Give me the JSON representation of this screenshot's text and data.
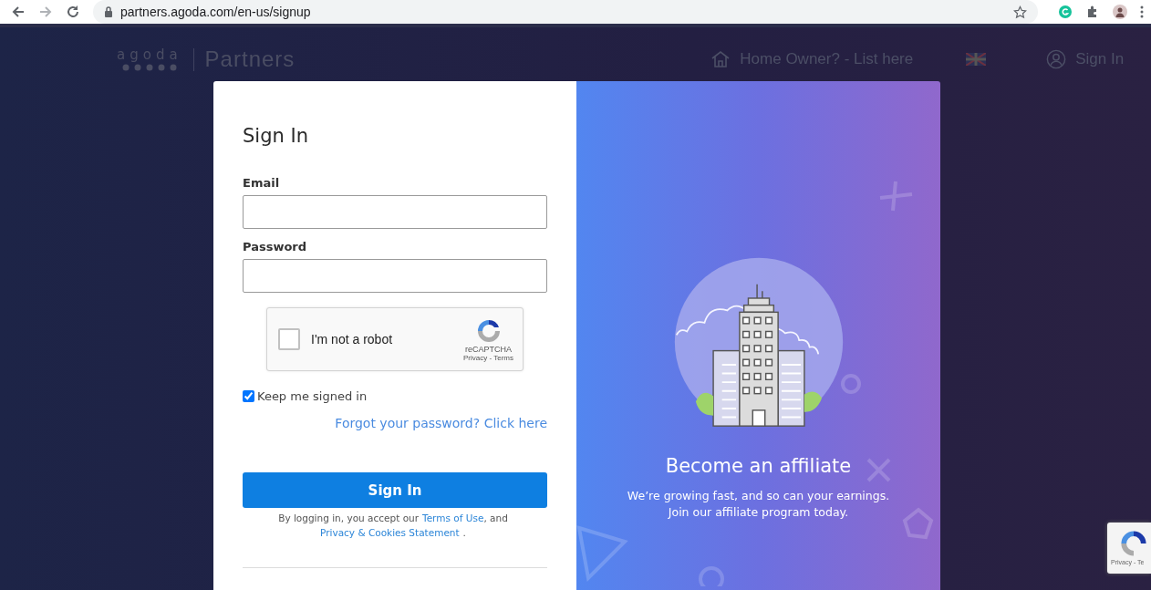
{
  "browser": {
    "url": "partners.agoda.com/en-us/signup"
  },
  "header": {
    "logo_word": "agoda",
    "logo_text": "Partners",
    "home_link": "Home Owner? - List here",
    "sign_in": "Sign In"
  },
  "signin": {
    "title": "Sign In",
    "fields": [
      {
        "label": "Email"
      },
      {
        "label": "Password"
      }
    ],
    "captcha": {
      "label": "I'm not a robot",
      "checked": false,
      "brand": "reCAPTCHA",
      "links": "Privacy - Terms"
    },
    "keep_signed_in": {
      "label": "Keep me signed in",
      "checked": true
    },
    "forgot": "Forgot your password? Click here",
    "button": "Sign In",
    "legal": {
      "before": "By logging in, you accept our",
      "terms": "Terms of Use",
      "middle": ", and",
      "privacy": "Privacy & Cookies Statement",
      "after": "."
    }
  },
  "promo": {
    "title": "Become an affiliate",
    "lines": [
      "We’re growing fast, and so can your earnings.",
      "Join our affiliate program today."
    ]
  },
  "captcha_badge": {
    "text": "Privacy - Te"
  }
}
